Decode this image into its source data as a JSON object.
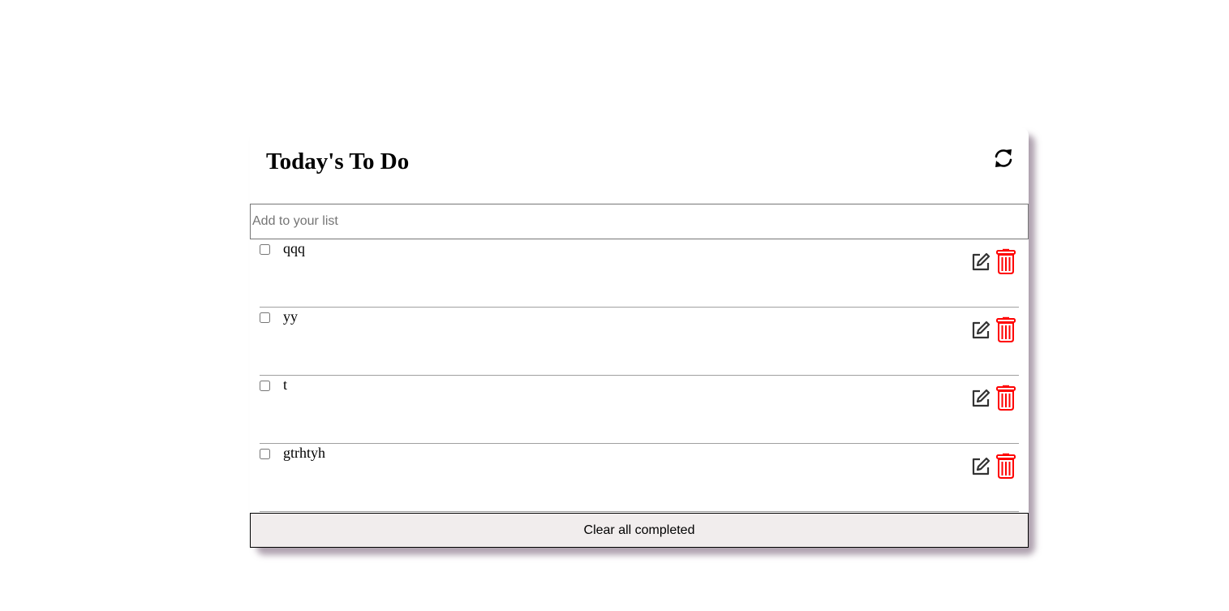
{
  "header": {
    "title": "Today's To Do",
    "refresh_icon": "refresh-icon"
  },
  "input": {
    "placeholder": "Add to your list",
    "value": ""
  },
  "todos": [
    {
      "label": "qqq",
      "completed": false
    },
    {
      "label": "yy",
      "completed": false
    },
    {
      "label": "t",
      "completed": false
    },
    {
      "label": "gtrhtyh",
      "completed": false
    }
  ],
  "item_icons": {
    "edit": "edit-icon",
    "delete": "trash-icon"
  },
  "footer": {
    "clear_label": "Clear all completed"
  },
  "colors": {
    "delete": "#ff0000",
    "clear_button_bg": "#f1eded",
    "shadow": "#6e556e"
  }
}
